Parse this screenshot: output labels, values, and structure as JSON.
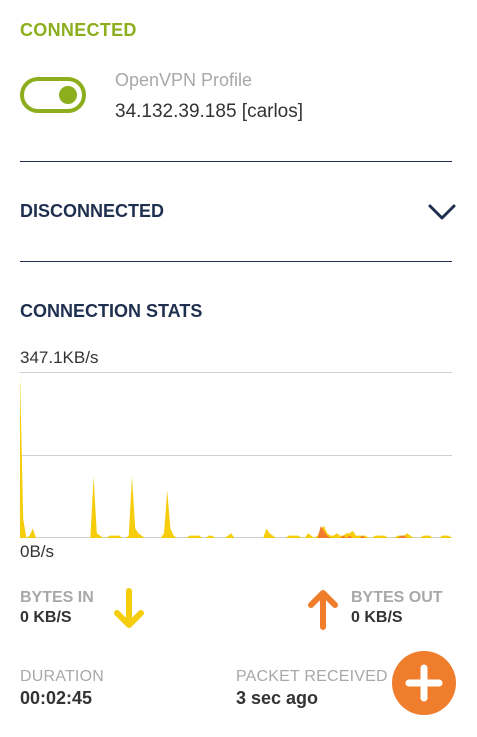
{
  "colors": {
    "connected_green": "#8dae1c",
    "navy": "#1f2f4f",
    "chart_yellow": "#f5cd0c",
    "chart_orange": "#f07d2c",
    "arrow_down_yellow": "#f5cd0c",
    "arrow_up_orange": "#f07d2c",
    "fab_orange": "#f07d2c",
    "label_gray": "#a8a8a8"
  },
  "connected": {
    "title": "CONNECTED",
    "toggle_on": true,
    "profile_name": "OpenVPN Profile",
    "profile_address": "34.132.39.185 [carlos]"
  },
  "disconnected": {
    "title": "DISCONNECTED",
    "icon": "chevron-down-icon"
  },
  "stats": {
    "title": "CONNECTION STATS",
    "max_label": "347.1KB/s",
    "min_label": "0B/s",
    "bytes_in_label": "BYTES IN",
    "bytes_in_value": "0 KB/S",
    "bytes_out_label": "BYTES OUT",
    "bytes_out_value": "0 KB/S",
    "duration_label": "DURATION",
    "duration_value": "00:02:45",
    "packet_label": "PACKET RECEIVED",
    "packet_value": "3 sec ago"
  },
  "chart_data": {
    "type": "area",
    "title": "",
    "xlabel": "",
    "ylabel": "",
    "ylim": [
      0,
      347.1
    ],
    "y_unit": "KB/s",
    "grid": true,
    "legend": "none",
    "series": [
      {
        "color": "#f5cd0c",
        "values": [
          347,
          40,
          0,
          5,
          20,
          0,
          0,
          0,
          0,
          0,
          0,
          0,
          0,
          0,
          0,
          0,
          0,
          0,
          0,
          0,
          0,
          0,
          0,
          130,
          10,
          5,
          0,
          0,
          5,
          5,
          5,
          5,
          0,
          0,
          5,
          130,
          20,
          10,
          5,
          0,
          0,
          0,
          0,
          0,
          0,
          10,
          100,
          20,
          5,
          0,
          0,
          0,
          0,
          5,
          5,
          5,
          5,
          0,
          0,
          5,
          5,
          0,
          0,
          0,
          0,
          5,
          10,
          0,
          0,
          0,
          0,
          0,
          0,
          0,
          0,
          0,
          0,
          20,
          10,
          5,
          0,
          0,
          0,
          0,
          5,
          5,
          5,
          5,
          0,
          0,
          10,
          5,
          0,
          5,
          20,
          25,
          10,
          5,
          5,
          10,
          5,
          5,
          10,
          10,
          15,
          5,
          5,
          5,
          5,
          0,
          0,
          5,
          5,
          5,
          5,
          0,
          0,
          0,
          5,
          5,
          5,
          10,
          5,
          0,
          0,
          0,
          5,
          5,
          5,
          0,
          0,
          0,
          5,
          5,
          5,
          0
        ]
      },
      {
        "color": "#f07d2c",
        "values": [
          0,
          0,
          0,
          0,
          0,
          0,
          0,
          0,
          0,
          0,
          0,
          0,
          0,
          0,
          0,
          0,
          0,
          0,
          0,
          0,
          0,
          0,
          0,
          0,
          0,
          0,
          0,
          0,
          0,
          0,
          0,
          0,
          0,
          0,
          0,
          0,
          0,
          0,
          0,
          0,
          0,
          0,
          0,
          0,
          0,
          0,
          0,
          0,
          0,
          0,
          0,
          0,
          0,
          0,
          0,
          0,
          0,
          0,
          0,
          0,
          0,
          0,
          0,
          0,
          0,
          0,
          0,
          0,
          0,
          0,
          0,
          0,
          0,
          0,
          0,
          0,
          0,
          0,
          0,
          0,
          0,
          0,
          0,
          0,
          0,
          0,
          0,
          0,
          0,
          0,
          0,
          0,
          0,
          0,
          25,
          15,
          5,
          0,
          0,
          0,
          0,
          5,
          0,
          5,
          0,
          0,
          0,
          5,
          0,
          0,
          0,
          0,
          0,
          0,
          0,
          0,
          0,
          0,
          0,
          5,
          5,
          0,
          0,
          0,
          0,
          0,
          0,
          0,
          0,
          0,
          0,
          0,
          0,
          0,
          0,
          0
        ]
      }
    ]
  },
  "fab": {
    "icon": "plus-icon"
  }
}
